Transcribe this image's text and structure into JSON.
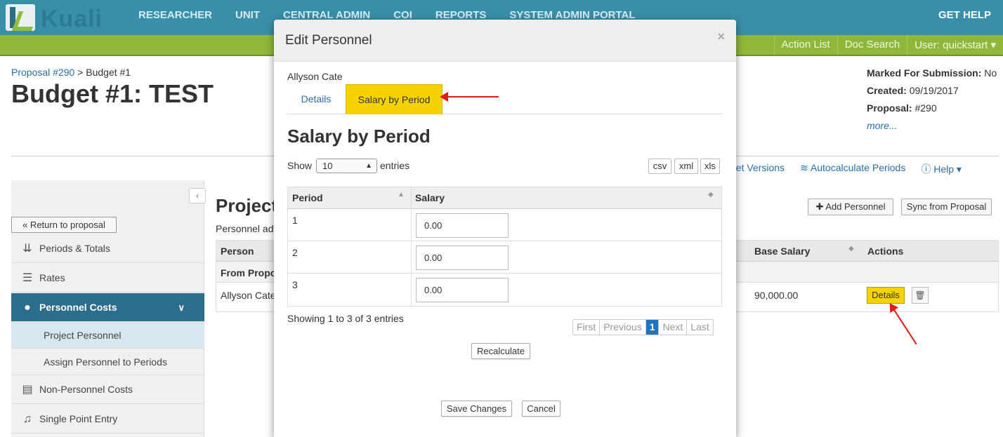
{
  "topnav": {
    "logo_text": "Kuali",
    "items": [
      "RESEARCHER",
      "UNIT",
      "CENTRAL ADMIN",
      "COI",
      "REPORTS",
      "SYSTEM ADMIN PORTAL"
    ],
    "get_help": "GET HELP"
  },
  "greenbar": {
    "links": [
      "Action List",
      "Doc Search",
      "User: quickstart ▾"
    ]
  },
  "page": {
    "breadcrumb_link": "Proposal #290",
    "breadcrumb_rest": " > Budget #1",
    "title": "Budget #1: TEST",
    "meta": {
      "marked_label": "Marked For Submission:",
      "marked_value": "No",
      "created_label": "Created:",
      "created_value": "09/19/2017",
      "proposal_label": "Proposal:",
      "proposal_value": "#290",
      "more": "more..."
    },
    "toollinks": [
      "get Versions",
      "Autocalculate Periods",
      "Help ▾"
    ]
  },
  "sidebar": {
    "return": "« Return to proposal",
    "items": [
      {
        "label": "Periods & Totals"
      },
      {
        "label": "Rates"
      },
      {
        "label": "Personnel Costs"
      },
      {
        "label": "Project Personnel"
      },
      {
        "label": "Assign Personnel to Periods"
      },
      {
        "label": "Non-Personnel Costs"
      },
      {
        "label": "Single Point Entry"
      }
    ]
  },
  "main": {
    "title": "Project",
    "subtitle": "Personnel ad",
    "add_personnel": "Add Personnel",
    "sync": "Sync from Proposal",
    "headers": {
      "person": "Person",
      "base_salary": "Base Salary",
      "actions": "Actions"
    },
    "group": "From Propo",
    "row": {
      "person": "Allyson Cate",
      "base_salary": "90,000.00",
      "details": "Details"
    }
  },
  "modal": {
    "title": "Edit Personnel",
    "close": "×",
    "person": "Allyson Cate",
    "tabs": [
      "Details",
      "Salary by Period"
    ],
    "section_title": "Salary by Period",
    "show_label": "Show",
    "page_size": "10",
    "entries_label": "entries",
    "export": [
      "csv",
      "xml",
      "xls"
    ],
    "headers": {
      "period": "Period",
      "salary": "Salary"
    },
    "rows": [
      {
        "period": "1",
        "salary": "0.00"
      },
      {
        "period": "2",
        "salary": "0.00"
      },
      {
        "period": "3",
        "salary": "0.00"
      }
    ],
    "showing": "Showing 1 to 3 of 3 entries",
    "pager": [
      "First",
      "Previous",
      "1",
      "Next",
      "Last"
    ],
    "recalculate": "Recalculate",
    "save": "Save Changes",
    "cancel": "Cancel"
  },
  "colors": {
    "nav_blue": "#3a8fa8",
    "green": "#8fb83a",
    "highlight_yellow": "#f6d300",
    "active_nav": "#2d6d8c",
    "annotation_red": "#e21a1a"
  }
}
